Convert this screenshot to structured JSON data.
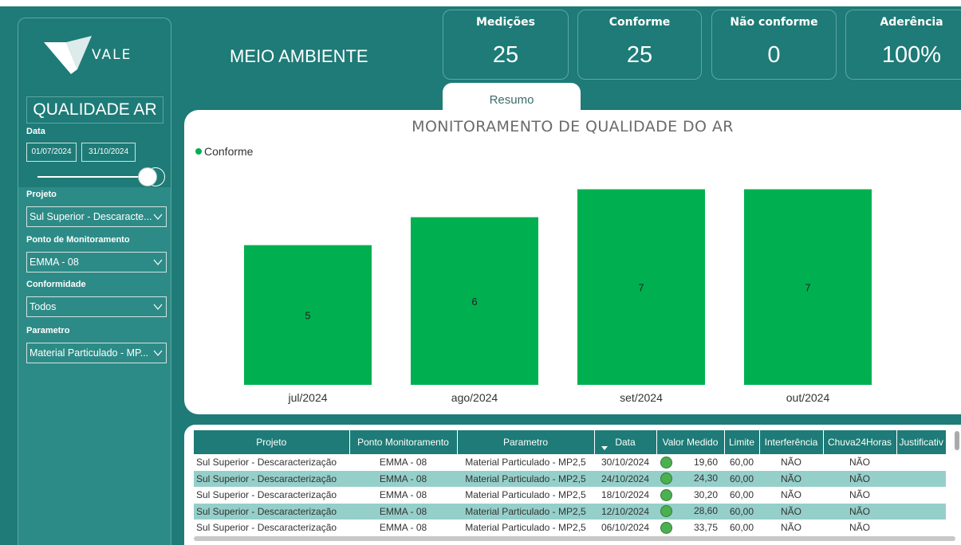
{
  "brand": {
    "logo_text": "VALE"
  },
  "header": {
    "title": "MEIO AMBIENTE"
  },
  "kpis": [
    {
      "label": "Medições",
      "value": "25"
    },
    {
      "label": "Conforme",
      "value": "25"
    },
    {
      "label": "Não conforme",
      "value": "0"
    },
    {
      "label": "Aderência",
      "value": "100%"
    }
  ],
  "sidebar": {
    "title": "QUALIDADE AR",
    "date_label": "Data",
    "date_start": "01/07/2024",
    "date_end": "31/10/2024",
    "filters": [
      {
        "label": "Projeto",
        "value": "Sul Superior - Descaracte..."
      },
      {
        "label": "Ponto de Monitoramento",
        "value": "EMMA - 08"
      },
      {
        "label": "Conformidade",
        "value": "Todos"
      },
      {
        "label": "Parametro",
        "value": "Material Particulado - MP..."
      }
    ]
  },
  "tab": {
    "label": "Resumo"
  },
  "chart_data": {
    "type": "bar",
    "title": "MONITORAMENTO DE QUALIDADE DO AR",
    "categories": [
      "jul/2024",
      "ago/2024",
      "set/2024",
      "out/2024"
    ],
    "series": [
      {
        "name": "Conforme",
        "values": [
          5,
          6,
          7,
          7
        ]
      }
    ],
    "legend": "top-left",
    "ylim": [
      0,
      7.5
    ],
    "grid": false,
    "colors": {
      "Conforme": "#00b050"
    }
  },
  "table": {
    "columns": [
      "Projeto",
      "Ponto Monitoramento",
      "Parametro",
      "Data",
      "Valor Medido",
      "Limite",
      "Interferência",
      "Chuva24Horas",
      "Justificativ"
    ],
    "rows": [
      [
        "Sul Superior - Descaracterização",
        "EMMA - 08",
        "Material Particulado - MP2,5",
        "30/10/2024",
        "19,60",
        "60,00",
        "NÃO",
        "NÃO",
        ""
      ],
      [
        "Sul Superior - Descaracterização",
        "EMMA - 08",
        "Material Particulado - MP2,5",
        "24/10/2024",
        "24,30",
        "60,00",
        "NÃO",
        "NÃO",
        ""
      ],
      [
        "Sul Superior - Descaracterização",
        "EMMA - 08",
        "Material Particulado - MP2,5",
        "18/10/2024",
        "30,20",
        "60,00",
        "NÃO",
        "NÃO",
        ""
      ],
      [
        "Sul Superior - Descaracterização",
        "EMMA - 08",
        "Material Particulado - MP2,5",
        "12/10/2024",
        "28,60",
        "60,00",
        "NÃO",
        "NÃO",
        ""
      ],
      [
        "Sul Superior - Descaracterização",
        "EMMA - 08",
        "Material Particulado - MP2,5",
        "06/10/2024",
        "33,75",
        "60,00",
        "NÃO",
        "NÃO",
        ""
      ]
    ]
  },
  "colors": {
    "accent": "#1e7b77",
    "row_alt": "#95cfca",
    "bar": "#00b050"
  }
}
